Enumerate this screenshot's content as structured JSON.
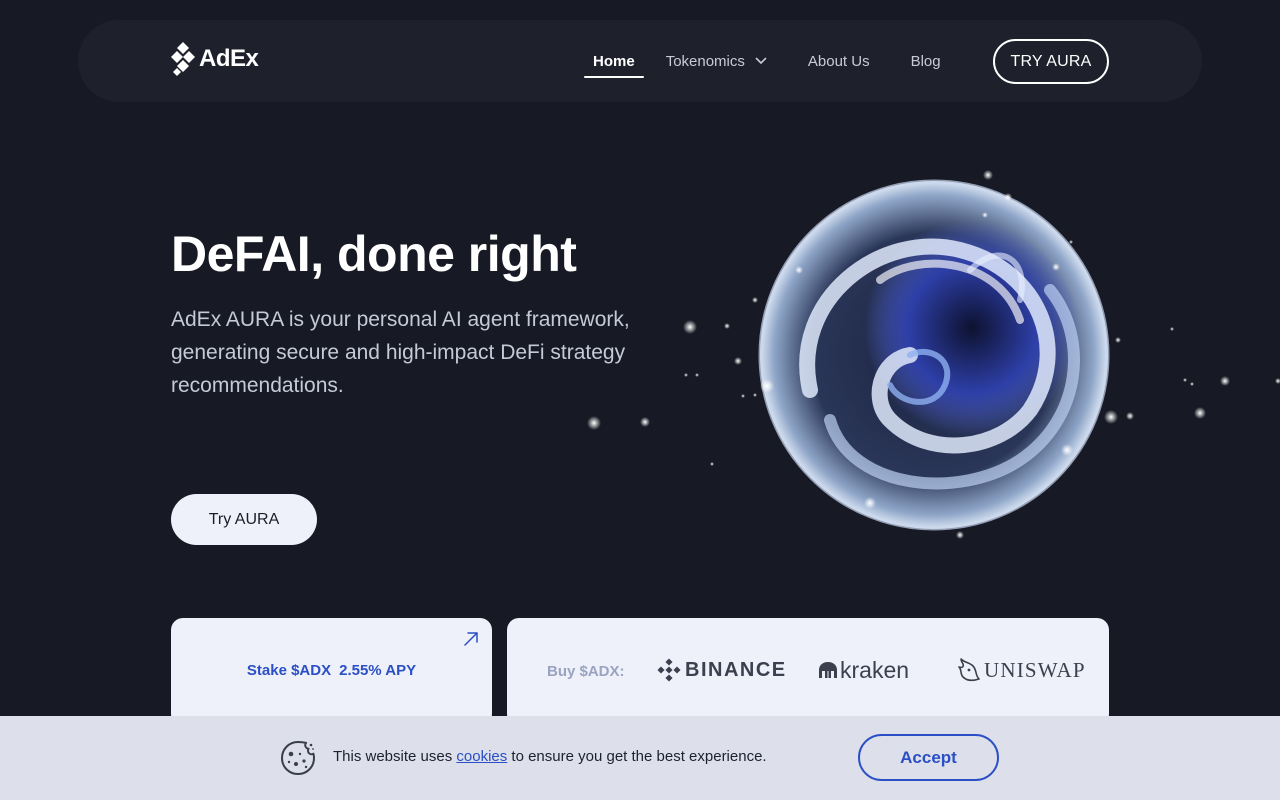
{
  "brand": {
    "name": "AdEx"
  },
  "nav": {
    "items": [
      {
        "label": "Home",
        "active": true
      },
      {
        "label": "Tokenomics",
        "has_dropdown": true
      },
      {
        "label": "About Us"
      },
      {
        "label": "Blog"
      }
    ],
    "cta_label": "TRY AURA"
  },
  "hero": {
    "title": "DeFAI, done right",
    "subtitle": "AdEx AURA is your personal AI agent framework, generating secure and high-impact DeFi strategy recommendations.",
    "button_label": "Try AURA"
  },
  "stake_card": {
    "label": "Stake $ADX",
    "apy": "2.55% APY",
    "icon": "external-link-icon"
  },
  "buy_card": {
    "label": "Buy $ADX:",
    "exchanges": [
      {
        "name": "BINANCE",
        "icon": "binance-icon"
      },
      {
        "name": "kraken",
        "icon": "kraken-icon"
      },
      {
        "name": "UNISWAP",
        "icon": "uniswap-icon"
      }
    ]
  },
  "cookie": {
    "text_before": "This website uses ",
    "link_label": "cookies",
    "text_after": " to ensure you get the best experience.",
    "accept_label": "Accept",
    "icon": "cookie-icon"
  },
  "colors": {
    "background": "#171a24",
    "nav_bg": "#1e212b",
    "card_bg": "#eef0fa",
    "accent_blue": "#2b4fc4",
    "cookie_bg": "#dde0ea"
  }
}
